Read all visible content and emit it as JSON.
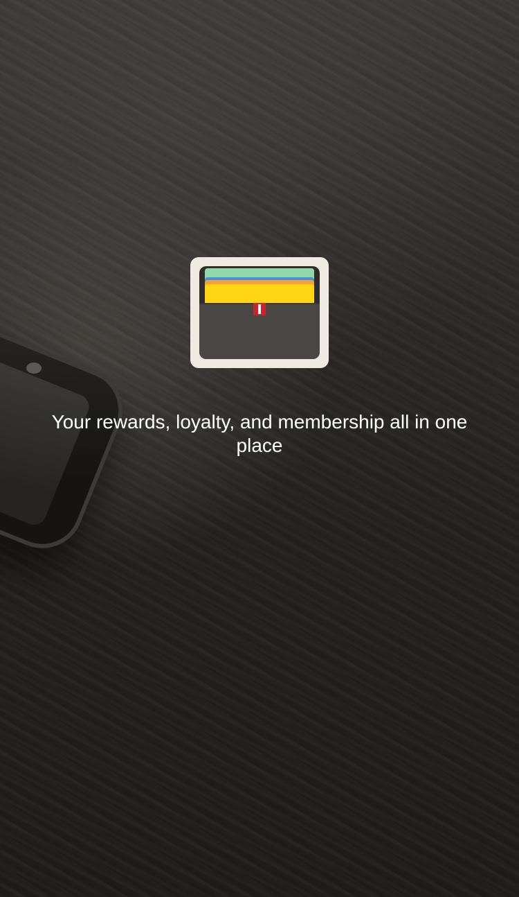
{
  "tagline": "Your rewards, loyalty, and membership all in one place",
  "icons": {
    "app_icon": "wallet-icon",
    "background_device": "phone"
  },
  "colors": {
    "icon_frame": "#efebe3",
    "wallet_body": "#4a4643",
    "card_green": "#8fd9a8",
    "card_blue": "#4a8fd8",
    "card_orange": "#f2a23a",
    "card_yellow": "#ffd514",
    "tab_red": "#c8262b",
    "text": "#ffffff"
  }
}
